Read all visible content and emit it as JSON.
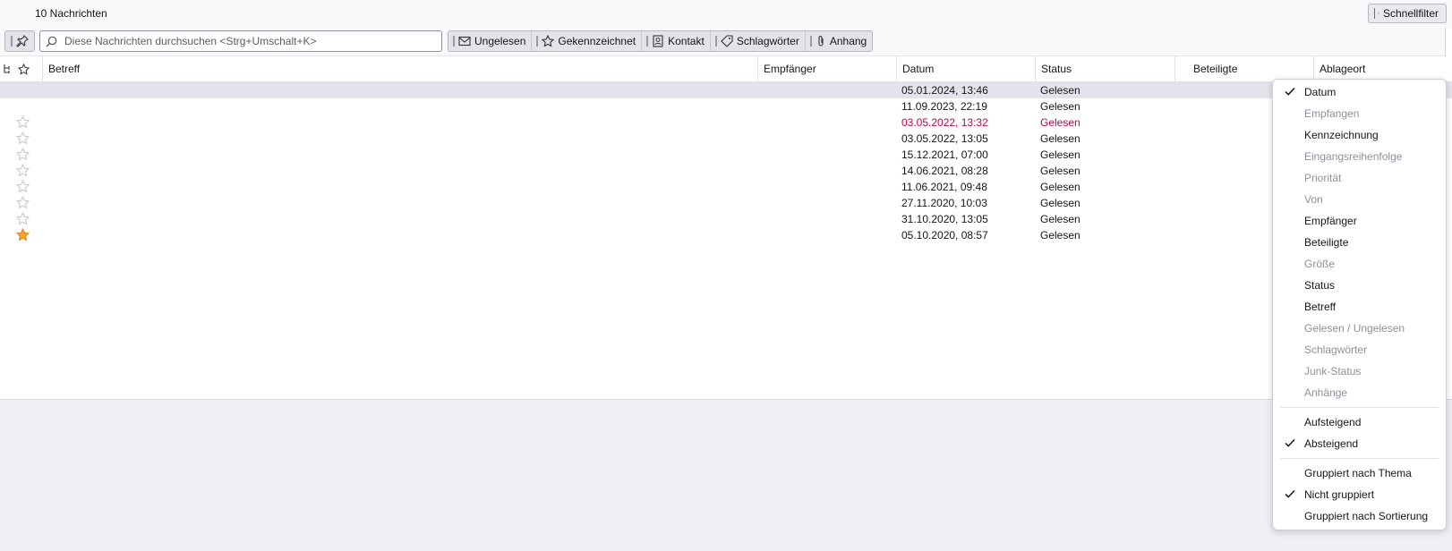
{
  "header": {
    "message_count": "10 Nachrichten",
    "quickfilter_label": "Schnellfilter"
  },
  "filterbar": {
    "search_placeholder": "Diese Nachrichten durchsuchen <Strg+Umschalt+K>",
    "filters": [
      "Ungelesen",
      "Gekennzeichnet",
      "Kontakt",
      "Schlagwörter",
      "Anhang"
    ]
  },
  "columns": {
    "subject": "Betreff",
    "recipient": "Empfänger",
    "date": "Datum",
    "status": "Status",
    "participants": "Beteiligte",
    "location": "Ablageort"
  },
  "rows": [
    {
      "date": "05.01.2024, 13:46",
      "status": "Gelesen",
      "starred": false,
      "selected": true,
      "red": false
    },
    {
      "date": "11.09.2023, 22:19",
      "status": "Gelesen",
      "starred": false,
      "selected": false,
      "red": false
    },
    {
      "date": "03.05.2022, 13:32",
      "status": "Gelesen",
      "starred": false,
      "selected": false,
      "red": true
    },
    {
      "date": "03.05.2022, 13:05",
      "status": "Gelesen",
      "starred": false,
      "selected": false,
      "red": false
    },
    {
      "date": "15.12.2021, 07:00",
      "status": "Gelesen",
      "starred": false,
      "selected": false,
      "red": false
    },
    {
      "date": "14.06.2021, 08:28",
      "status": "Gelesen",
      "starred": false,
      "selected": false,
      "red": false
    },
    {
      "date": "11.06.2021, 09:48",
      "status": "Gelesen",
      "starred": false,
      "selected": false,
      "red": false
    },
    {
      "date": "27.11.2020, 10:03",
      "status": "Gelesen",
      "starred": false,
      "selected": false,
      "red": false
    },
    {
      "date": "31.10.2020, 13:05",
      "status": "Gelesen",
      "starred": false,
      "selected": false,
      "red": false
    },
    {
      "date": "05.10.2020, 08:57",
      "status": "Gelesen",
      "starred": true,
      "selected": false,
      "red": false
    }
  ],
  "sort_menu": {
    "sort_items": [
      {
        "label": "Datum",
        "checked": true,
        "disabled": false
      },
      {
        "label": "Empfangen",
        "checked": false,
        "disabled": true
      },
      {
        "label": "Kennzeichnung",
        "checked": false,
        "disabled": false
      },
      {
        "label": "Eingangsreihenfolge",
        "checked": false,
        "disabled": true
      },
      {
        "label": "Priorität",
        "checked": false,
        "disabled": true
      },
      {
        "label": "Von",
        "checked": false,
        "disabled": true
      },
      {
        "label": "Empfänger",
        "checked": false,
        "disabled": false
      },
      {
        "label": "Beteiligte",
        "checked": false,
        "disabled": false
      },
      {
        "label": "Größe",
        "checked": false,
        "disabled": true
      },
      {
        "label": "Status",
        "checked": false,
        "disabled": false
      },
      {
        "label": "Betreff",
        "checked": false,
        "disabled": false
      },
      {
        "label": "Gelesen / Ungelesen",
        "checked": false,
        "disabled": true
      },
      {
        "label": "Schlagwörter",
        "checked": false,
        "disabled": true
      },
      {
        "label": "Junk-Status",
        "checked": false,
        "disabled": true
      },
      {
        "label": "Anhänge",
        "checked": false,
        "disabled": true
      }
    ],
    "order_items": [
      {
        "label": "Aufsteigend",
        "checked": false,
        "disabled": false
      },
      {
        "label": "Absteigend",
        "checked": true,
        "disabled": false
      }
    ],
    "group_items": [
      {
        "label": "Gruppiert nach Thema",
        "checked": false,
        "disabled": false
      },
      {
        "label": "Nicht gruppiert",
        "checked": true,
        "disabled": false
      },
      {
        "label": "Gruppiert nach Sortierung",
        "checked": false,
        "disabled": false
      }
    ]
  },
  "colors": {
    "accent": "#0a84ff",
    "selected_row": "#e3e3ec",
    "red_text": "#c50042",
    "star_filled": "#f5a33a"
  }
}
